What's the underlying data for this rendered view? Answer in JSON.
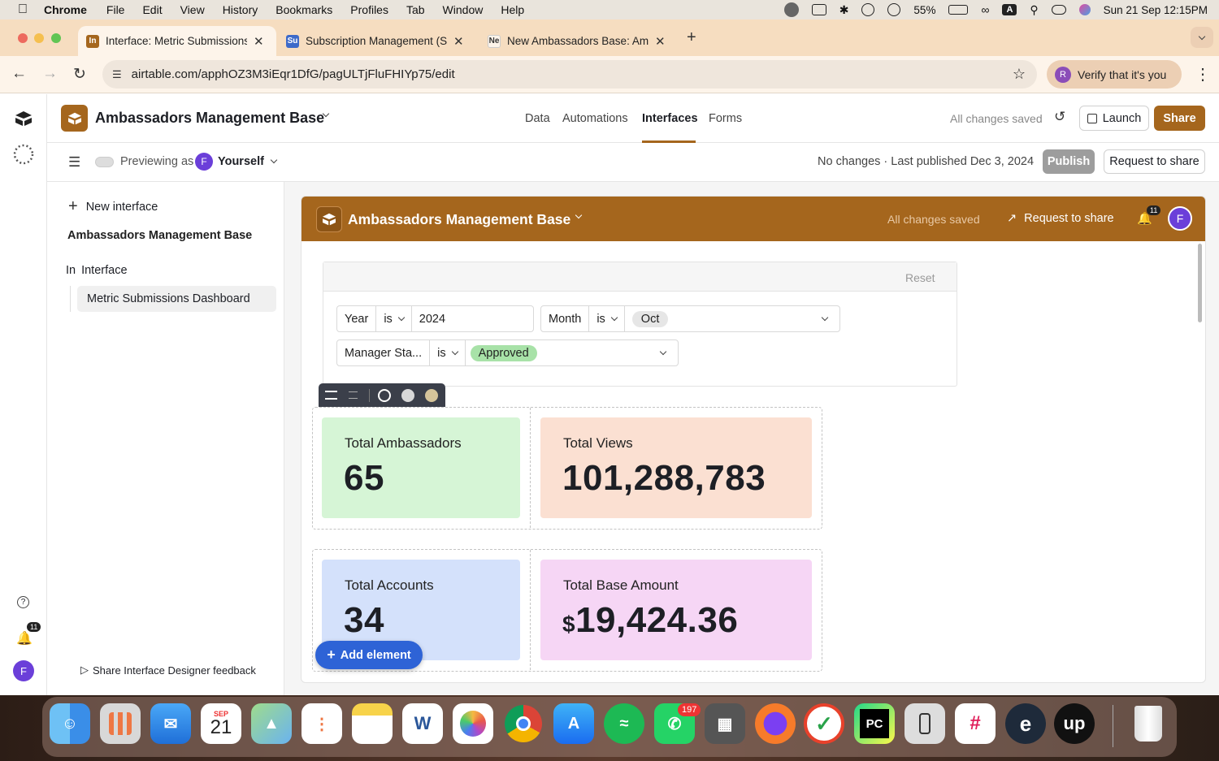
{
  "menubar": {
    "app": "Chrome",
    "items": [
      "File",
      "Edit",
      "View",
      "History",
      "Bookmarks",
      "Profiles",
      "Tab",
      "Window",
      "Help"
    ],
    "battery": "55%",
    "input_indicator": "A",
    "datetime": "Sun 21 Sep  12:15PM"
  },
  "tabs": [
    {
      "favicon": "In",
      "title": "Interface: Metric Submissions",
      "color": "#a5661d"
    },
    {
      "favicon": "Su",
      "title": "Subscription Management (S",
      "color": "#3d6ac9"
    },
    {
      "favicon": "Ne",
      "title": "New Ambassadors Base: Amb",
      "color": "#fdf4ea"
    }
  ],
  "toolbar": {
    "url": "airtable.com/apphOZ3M3iEqr1DfG/pagULTjFluFHIYp75/edit",
    "verify": "Verify that it's you",
    "verify_avatar": "R"
  },
  "app": {
    "base_name": "Ambassadors Management Base",
    "nav": [
      "Data",
      "Automations",
      "Interfaces",
      "Forms"
    ],
    "active_nav": "Interfaces",
    "save_status": "All changes saved",
    "launch": "Launch",
    "share": "Share",
    "previewing_as": "Previewing as",
    "preview_user": "Yourself",
    "preview_avatar": "F",
    "publish_status": "No changes · Last published Dec 3, 2024",
    "publish": "Publish",
    "request_share": "Request to share"
  },
  "sidebar": {
    "new_interface": "New interface",
    "base_name": "Ambassadors Management Base",
    "group_prefix": "In",
    "group_label": "Interface",
    "page": "Metric Submissions Dashboard",
    "feedback": "Share Interface Designer feedback",
    "notif_count": "11",
    "avatar": "F"
  },
  "interface": {
    "title": "Ambassadors Management Base",
    "save_status": "All changes saved",
    "request_share": "Request to share",
    "notif_count": "11",
    "avatar": "F",
    "reset": "Reset",
    "filters": {
      "year_field": "Year",
      "year_op": "is",
      "year_value": "2024",
      "month_field": "Month",
      "month_op": "is",
      "month_value": "Oct",
      "manager_field": "Manager Sta...",
      "manager_op": "is",
      "manager_value": "Approved"
    },
    "metrics": [
      {
        "label": "Total Ambassadors",
        "value": "65",
        "color": "#d6f5d6"
      },
      {
        "label": "Total Views",
        "value": "101,288,783",
        "color": "#fbe0d2"
      },
      {
        "label": "Total Accounts",
        "value": "34",
        "color": "#d4e1fb"
      },
      {
        "label": "Total Base Amount",
        "currency": "$",
        "value": "19,424.36",
        "color": "#f6d6f5"
      }
    ],
    "add_element": "Add element"
  },
  "dock": {
    "calendar_month": "SEP",
    "calendar_day": "21",
    "whatsapp_badge": "197"
  },
  "colors": {
    "brand": "#a5661d",
    "avatar": "#6b3fd9",
    "approved_chip": "#a8e2a8",
    "add_element": "#2e63d6"
  }
}
